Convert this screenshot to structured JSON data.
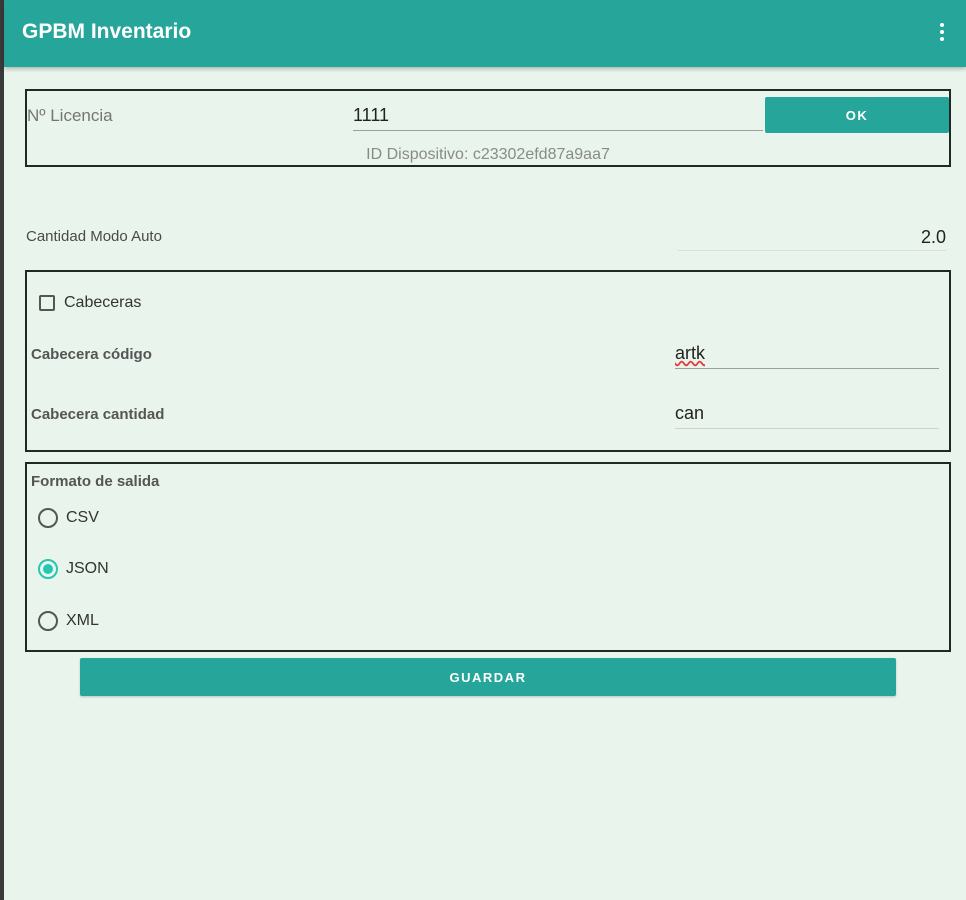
{
  "app": {
    "title": "GPBM Inventario"
  },
  "license": {
    "label": "Nº Licencia",
    "value": "1111",
    "ok_label": "OK",
    "device_id": "ID Dispositivo: c23302efd87a9aa7"
  },
  "auto": {
    "label": "Cantidad Modo Auto",
    "value": "2.0"
  },
  "headers": {
    "checkbox_label": "Cabeceras",
    "checked": false,
    "code_label": "Cabecera código",
    "code_value": "artk",
    "qty_label": "Cabecera cantidad",
    "qty_value": "can"
  },
  "format": {
    "title": "Formato de salida",
    "options": [
      "CSV",
      "JSON",
      "XML"
    ],
    "selected": "JSON"
  },
  "save_label": "GUARDAR",
  "colors": {
    "primary": "#26a69a",
    "accent": "#26c6b5",
    "background": "#e9f4ec"
  },
  "icons": {
    "overflow": "more-vert-icon"
  }
}
